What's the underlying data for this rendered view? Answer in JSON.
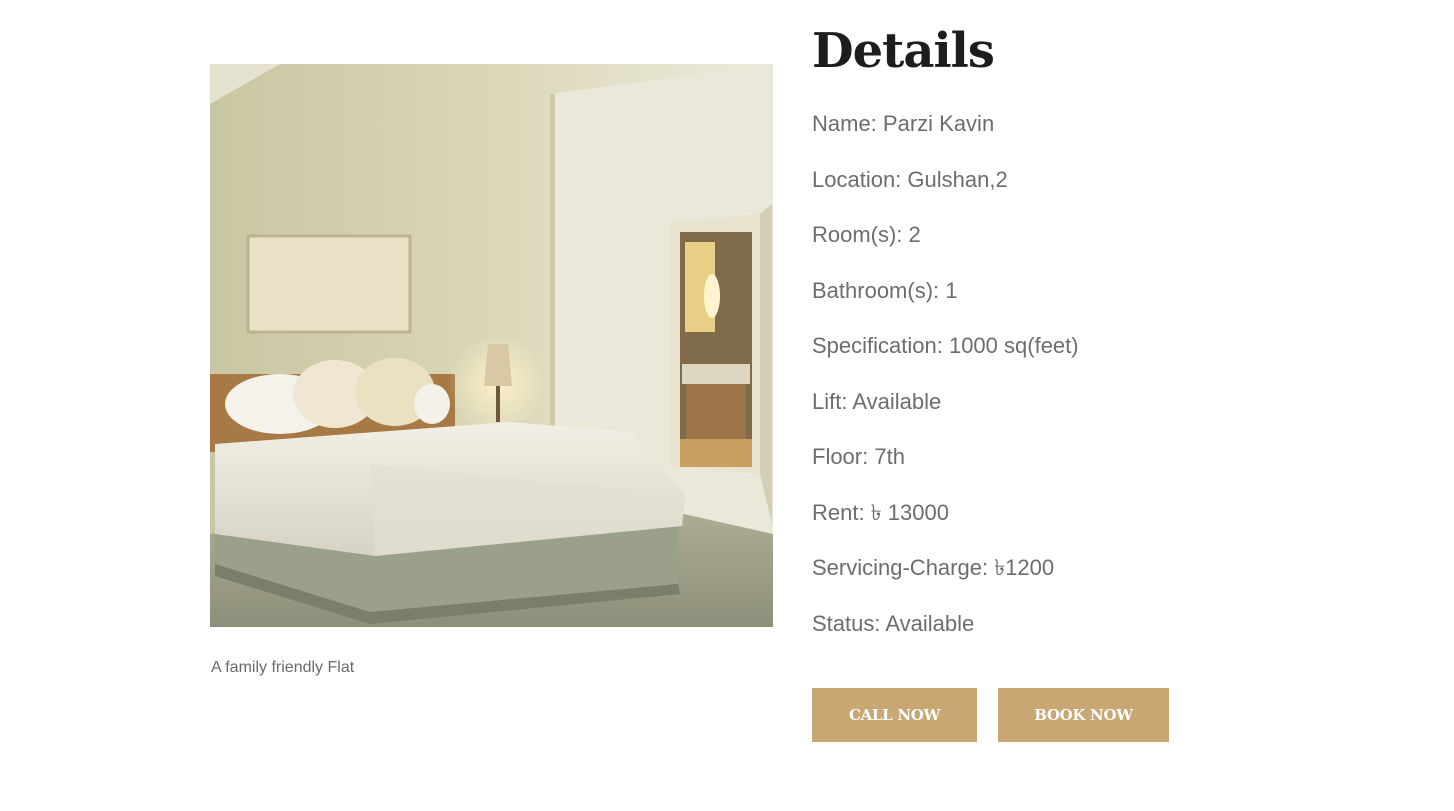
{
  "listing": {
    "photo_alt": "Bedroom with double bed, pillows, lamp and open bathroom door",
    "caption": "A family friendly Flat"
  },
  "details": {
    "title": "Details",
    "rows": [
      "Name: Parzi Kavin",
      "Location: Gulshan,2",
      "Room(s): 2",
      "Bathroom(s): 1",
      "Specification: 1000 sq(feet)",
      "Lift: Available",
      "Floor: 7th",
      "Rent: ৳ 13000",
      "Servicing-Charge: ৳1200",
      "Status: Available"
    ]
  },
  "actions": {
    "call_label": "CALL NOW",
    "book_label": "BOOK NOW"
  },
  "colors": {
    "accent": "#c9a773",
    "heading": "#1d1d1d",
    "text": "#6d6d6d"
  }
}
